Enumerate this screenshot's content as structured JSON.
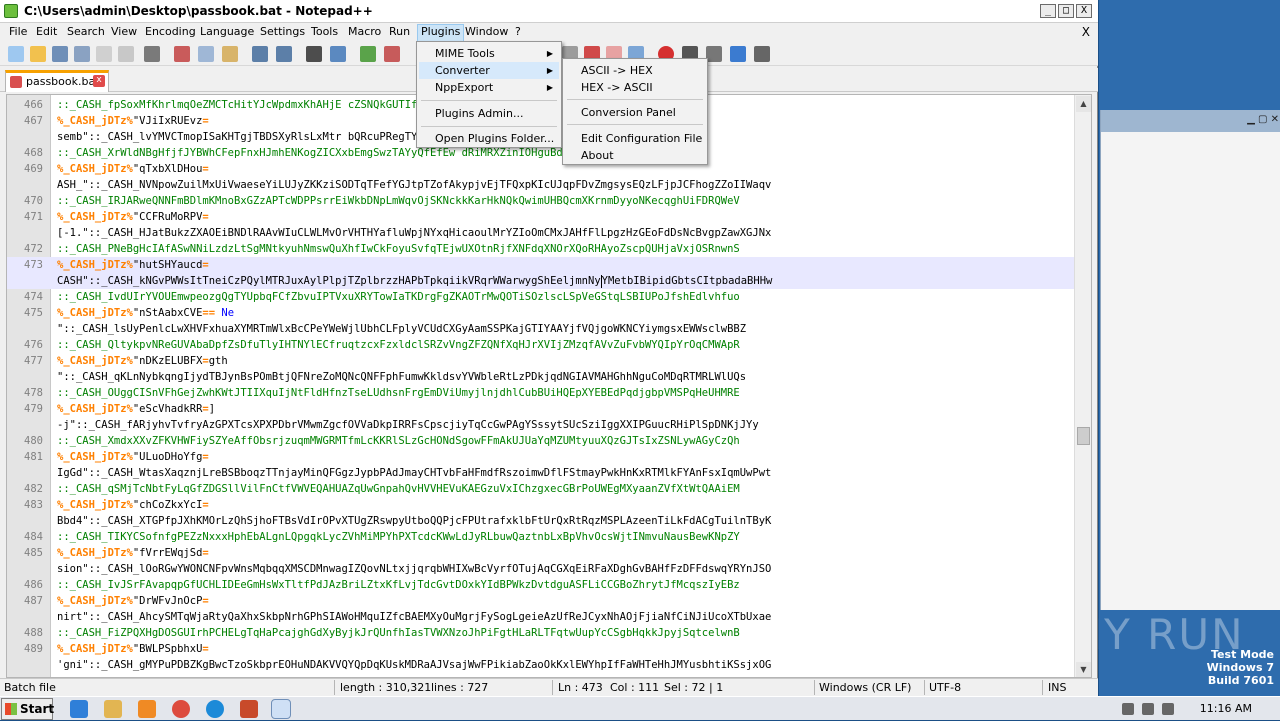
{
  "window": {
    "title": "C:\\Users\\admin\\Desktop\\passbook.bat - Notepad++",
    "close_x": "X",
    "btn_min": "_",
    "btn_max": "□",
    "btn_close": "X"
  },
  "menubar": [
    "File",
    "Edit",
    "Search",
    "View",
    "Encoding",
    "Language",
    "Settings",
    "Tools",
    "Macro",
    "Run",
    "Plugins",
    "Window",
    "?"
  ],
  "tab": {
    "label": "passbook.bat",
    "close": "x"
  },
  "plugins_menu": {
    "items": [
      "MIME Tools",
      "Converter",
      "NppExport",
      "Plugins Admin...",
      "Open Plugins Folder..."
    ]
  },
  "converter_menu": {
    "items": [
      "ASCII -> HEX",
      "HEX -> ASCII",
      "Conversion Panel",
      "Edit Configuration File",
      "About"
    ]
  },
  "editor": {
    "lines": [
      {
        "n": "466",
        "parts": [
          {
            "c": "green",
            "t": "::_CASH_fpSoxMfKhrlmqOeZMCTcHitYJcWpdmxKhAHjE"
          },
          {
            "c": "green",
            "t": "                                                              "
          },
          {
            "c": "green",
            "t": "cZSNQkGUTIfpPmzCJNkXZMmhzJl"
          }
        ]
      },
      {
        "n": "467",
        "parts": [
          {
            "c": "label",
            "t": "%_CASH_jDTz%"
          },
          {
            "c": "black",
            "t": "\"VJiIxRUEvz"
          },
          {
            "c": "label",
            "t": "="
          }
        ]
      },
      {
        "n": "",
        "parts": [
          {
            "c": "black",
            "t": "semb\"::_CASH_lvYMVCTmopISaKHTgjTBDSXyRlsLxMtr"
          },
          {
            "c": "black",
            "t": "                                                              "
          },
          {
            "c": "black",
            "t": "bQRcuPRegTYPCVJTbIGJActCjfUCJkji"
          }
        ]
      },
      {
        "n": "468",
        "parts": [
          {
            "c": "green",
            "t": "::_CASH_XrWldNBgHfjfJYBWhCFepFnxHJmhENKogZICXxbEmgSwzTAYyQfEfEw"
          },
          {
            "c": "green",
            "t": "                                            "
          },
          {
            "c": "green",
            "t": "dRiMRXZinIOHguBdqyyUHbUFXbE"
          }
        ]
      },
      {
        "n": "469",
        "parts": [
          {
            "c": "label",
            "t": "%_CASH_jDTz%"
          },
          {
            "c": "black",
            "t": "\"qTxbXlDHou"
          },
          {
            "c": "label",
            "t": "="
          }
        ]
      },
      {
        "n": "",
        "parts": [
          {
            "c": "black",
            "t": "ASH_\"::_CASH_NVNpowZuilMxUiVwaeseYiLUJyZKKziSODTqTFefYGJtpTZofAkypjvEjTFQxpKIcUJqpFDvZmgsysEQzLFjpJCFhogZZoIIWaqv"
          }
        ]
      },
      {
        "n": "470",
        "parts": [
          {
            "c": "green",
            "t": "::_CASH_IRJARweQNNFmBDlmKMnoBxGZzAPTcWDPPsrrEiWkbDNpLmWqvOjSKNckkKarHkNQkQwimUHBQcmXKrnmDyyoNKecqghUiFDRQWeV"
          }
        ]
      },
      {
        "n": "471",
        "parts": [
          {
            "c": "label",
            "t": "%_CASH_jDTz%"
          },
          {
            "c": "black",
            "t": "\"CCFRuMoRPV"
          },
          {
            "c": "label",
            "t": "="
          }
        ]
      },
      {
        "n": "",
        "parts": [
          {
            "c": "black",
            "t": "[-1.\"::_CASH_HJatBukzZXAOEiBNDlRAAvWIuCLWLMvOrVHTHYafluWpjNYxqHicaoulMrYZIoOmCMxJAHfFlLpgzHzGEoFdDsNcBvgpZawXGJNx"
          }
        ]
      },
      {
        "n": "472",
        "parts": [
          {
            "c": "green",
            "t": "::_CASH_PNeBgHcIAfASwNNiLzdzLtSgMNtkyuhNmswQuXhfIwCkFoyuSvfqTEjwUXOtnRjfXNFdqXNOrXQoRHAyoZscpQUHjaVxjOSRnwnS"
          }
        ]
      },
      {
        "n": "473",
        "cur": true,
        "parts": [
          {
            "c": "label",
            "t": "%_CASH_jDTz%"
          },
          {
            "c": "black",
            "t": "\"hutSHYaucd"
          },
          {
            "c": "label",
            "t": "="
          }
        ]
      },
      {
        "n": "",
        "cur": true,
        "caret": true,
        "parts": [
          {
            "c": "black",
            "t": "CASH\"::_CASH_kNGvPWWsItTneiCzPQylMTRJuxAylPlpjTZplbrzzHAPbTpkqiikVRqrWWarwygShEeljmnNy"
          },
          {
            "c": "caret",
            "t": ""
          },
          {
            "c": "black",
            "t": "YMetbIBipidGbtsCItpbadaBHHw"
          }
        ]
      },
      {
        "n": "474",
        "parts": [
          {
            "c": "green",
            "t": "::_CASH_IvdUIrYVOUEmwpeozgQgTYUpbqFCfZbvuIPTVxuXRYTowIaTKDrgFgZKAOTrMwQOTiSOzlscLSpVeGStqLSBIUPoJfshEdlvhfuo"
          }
        ]
      },
      {
        "n": "475",
        "parts": [
          {
            "c": "label",
            "t": "%_CASH_jDTz%"
          },
          {
            "c": "black",
            "t": "\"nStAabxCVE"
          },
          {
            "c": "label",
            "t": "=="
          },
          {
            "c": "blue",
            "t": " Ne"
          }
        ]
      },
      {
        "n": "",
        "parts": [
          {
            "c": "black",
            "t": "\"::_CASH_lsUyPenlcLwXHVFxhuaXYMRTmWlxBcCPeYWeWjlUbhCLFplyVCUdCXGyAamSSPKajGTIYAAYjfVQjgoWKNCYiymgsxEWWsclwBBZ"
          }
        ]
      },
      {
        "n": "476",
        "parts": [
          {
            "c": "green",
            "t": "::_CASH_QltykpvNReGUVAbaDpfZsDfuTlyIHTNYlECfruqtzcxFzxldclSRZvVngZFZQNfXqHJrXVIjZMzqfAVvZuFvbWYQIpYrOqCMWApR"
          }
        ]
      },
      {
        "n": "477",
        "parts": [
          {
            "c": "label",
            "t": "%_CASH_jDTz%"
          },
          {
            "c": "black",
            "t": "\"nDKzELUBFX"
          },
          {
            "c": "label",
            "t": "="
          },
          {
            "c": "black",
            "t": "gth"
          }
        ]
      },
      {
        "n": "",
        "parts": [
          {
            "c": "black",
            "t": "\"::_CASH_qKLnNybkqngIjydTBJynBsPOmBtjQFNreZoMQNcQNFFphFumwKkldsvYVWbleRtLzPDkjqdNGIAVMAHGhhNguCoMDqRTMRLWlUQs"
          }
        ]
      },
      {
        "n": "478",
        "parts": [
          {
            "c": "green",
            "t": "::_CASH_OUggCISnVFhGejZwhKWtJTIIXquIjNtFldHfnzTseLUdhsnFrgEmDViUmyjlnjdhlCubBUiHQEpXYEBEdPqdjgbpVMSPqHeUHMRE"
          }
        ]
      },
      {
        "n": "479",
        "parts": [
          {
            "c": "label",
            "t": "%_CASH_jDTz%"
          },
          {
            "c": "black",
            "t": "\"eScVhadkRR"
          },
          {
            "c": "label",
            "t": "="
          },
          {
            "c": "black",
            "t": "]"
          }
        ]
      },
      {
        "n": "",
        "parts": [
          {
            "c": "black",
            "t": "-j\"::_CASH_fARjyhvTvfryAzGPXTcsXPXPDbrVMwmZgcfOVVaDkpIRRFsCpscjiyTqCcGwPAgYSssytSUcSziIggXXIPGuucRHiPlSpDNKjJYy"
          }
        ]
      },
      {
        "n": "480",
        "parts": [
          {
            "c": "green",
            "t": "::_CASH_XmdxXXvZFKVHWFiySZYeAffObsrjzuqmMWGRMTfmLcKKRlSLzGcHONdSgowFFmAkUJUaYqMZUMtyuuXQzGJTsIxZSNLywAGyCzQh"
          }
        ]
      },
      {
        "n": "481",
        "parts": [
          {
            "c": "label",
            "t": "%_CASH_jDTz%"
          },
          {
            "c": "black",
            "t": "\"ULuoDHoYfg"
          },
          {
            "c": "label",
            "t": "="
          }
        ]
      },
      {
        "n": "",
        "parts": [
          {
            "c": "black",
            "t": "IgGd\"::_CASH_WtasXaqznjLreBSBboqzTTnjayMinQFGgzJypbPAdJmayCHTvbFaHFmdfRszoimwDflFStmayPwkHnKxRTMlkFYAnFsxIqmUwPwt"
          }
        ]
      },
      {
        "n": "482",
        "parts": [
          {
            "c": "green",
            "t": "::_CASH_qSMjTcNbtFyLqGfZDGSllVilFnCtfVWVEQAHUAZqUwGnpahQvHVVHEVuKAEGzuVxIChzgxecGBrPoUWEgMXyaanZVfXtWtQAAiEM"
          }
        ]
      },
      {
        "n": "483",
        "parts": [
          {
            "c": "label",
            "t": "%_CASH_jDTz%"
          },
          {
            "c": "black",
            "t": "\"chCoZkxYcI"
          },
          {
            "c": "label",
            "t": "="
          }
        ]
      },
      {
        "n": "",
        "parts": [
          {
            "c": "black",
            "t": "Bbd4\"::_CASH_XTGPfpJXhKMOrLzQhSjhoFTBsVdIrOPvXTUgZRswpyUtboQQPjcFPUtrafxklbFtUrQxRtRqzMSPLAzeenTiLkFdACgTuilnTByK"
          }
        ]
      },
      {
        "n": "484",
        "parts": [
          {
            "c": "green",
            "t": "::_CASH_TIKYCSofnfgPEZzNxxxHphEbALgnLQpgqkLycZVhMiMPYhPXTcdcKWwLdJyRLbuwQaztnbLxBpVhvOcsWjtINmvuNausBewKNpZY"
          }
        ]
      },
      {
        "n": "485",
        "parts": [
          {
            "c": "label",
            "t": "%_CASH_jDTz%"
          },
          {
            "c": "black",
            "t": "\"fVrrEWqjSd"
          },
          {
            "c": "label",
            "t": "="
          }
        ]
      },
      {
        "n": "",
        "parts": [
          {
            "c": "black",
            "t": "sion\"::_CASH_lOoRGwYWONCNFpvWnsMqbqqXMSCDMnwagIZQovNLtxjjqrqbWHIXwBcVyrfOTujAqCGXqEiRFaXDghGvBAHfFzDFFdswqYRYnJSO"
          }
        ]
      },
      {
        "n": "486",
        "parts": [
          {
            "c": "green",
            "t": "::_CASH_IvJSrFAvapqpGfUCHLIDEeGmHsWxTltfPdJAzBriLZtxKfLvjTdcGvtDOxkYIdBPWkzDvtdguASFLiCCGBoZhrytJfMcqszIyEBz"
          }
        ]
      },
      {
        "n": "487",
        "parts": [
          {
            "c": "label",
            "t": "%_CASH_jDTz%"
          },
          {
            "c": "black",
            "t": "\"DrWFvJnOcP"
          },
          {
            "c": "label",
            "t": "="
          }
        ]
      },
      {
        "n": "",
        "parts": [
          {
            "c": "black",
            "t": "nirt\"::_CASH_AhcySMTqWjaRtyQaXhxSkbpNrhGPhSIAWoHMquIZfcBAEMXyOuMgrjFySogLgeieAzUfReJCyxNhAOjFjiaNfCiNJiUcoXTbUxae"
          }
        ]
      },
      {
        "n": "488",
        "parts": [
          {
            "c": "green",
            "t": "::_CASH_FiZPQXHgDOSGUIrhPCHELgTqHaPcajghGdXyByjkJrQUnfhIasTVWXNzoJhPiFgtHLaRLTFqtwUupYcCSgbHqkkJpyjSqtcelwnB"
          }
        ]
      },
      {
        "n": "489",
        "parts": [
          {
            "c": "label",
            "t": "%_CASH_jDTz%"
          },
          {
            "c": "black",
            "t": "\"BWLPSpbhxU"
          },
          {
            "c": "label",
            "t": "="
          }
        ]
      },
      {
        "n": "",
        "parts": [
          {
            "c": "black",
            "t": "'gni\"::_CASH_gMYPuPDBZKgBwcTzoSkbprEOHuNDAKVVQYQpDqKUskMDRaAJVsajWwFPikiabZaoOkKxlEWYhpIfFaWHTeHhJMYusbhtiKSsjxOG"
          }
        ]
      }
    ]
  },
  "statusbar": {
    "type": "Batch file",
    "length": "length : 310,321",
    "lines": "lines : 727",
    "ln": "Ln : 473",
    "col": "Col : 111",
    "sel": "Sel : 72 | 1",
    "eol": "Windows (CR LF)",
    "enc": "UTF-8",
    "ins": "INS"
  },
  "desktop": {
    "watermark": "ANY RUN",
    "testmode": [
      "Test Mode",
      "Windows 7",
      "Build 7601"
    ]
  },
  "taskbar": {
    "start": "Start",
    "clock": "11:16 AM"
  },
  "colors": {
    "comment": "#008000",
    "label": "#ff8000",
    "accent_tab": "#f7a100"
  }
}
